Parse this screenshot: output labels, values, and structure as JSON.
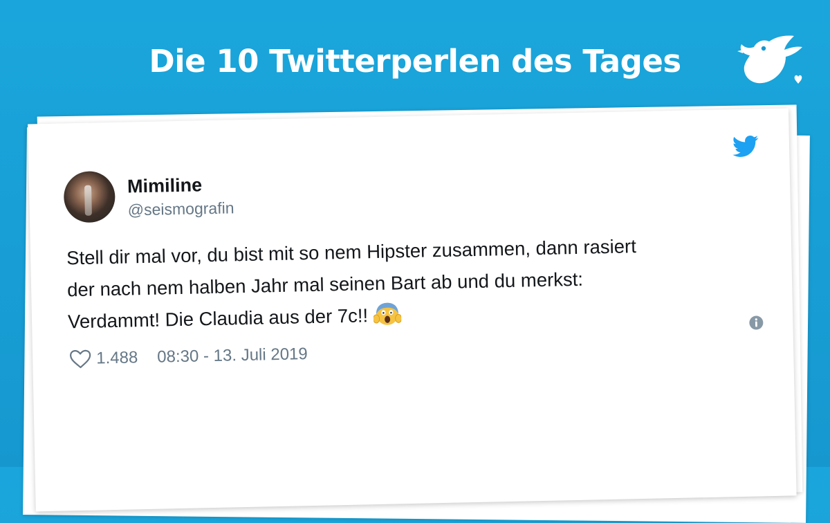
{
  "header": {
    "title": "Die 10 Twitterperlen des Tages",
    "brand_icon": "bird-heart-logo-icon"
  },
  "tweet": {
    "platform_icon": "twitter-bird-icon",
    "avatar_icon": "avatar",
    "display_name": "Mimiline",
    "handle": "@seismografin",
    "text_lines": [
      "Stell dir mal vor, du bist mit so nem Hipster zusammen, dann rasiert",
      "der nach nem halben Jahr mal seinen Bart ab und du merkst:",
      "Verdammt! Die Claudia aus der 7c!!"
    ],
    "emoji": "face-screaming-in-fear-icon",
    "likes_icon": "heart-outline-icon",
    "likes": "1.488",
    "timestamp": "08:30 - 13. Juli 2019",
    "info_icon": "info-icon"
  },
  "colors": {
    "background": "#1aa6dc",
    "twitter_blue": "#1da1f2",
    "muted_text": "#657786",
    "text": "#14171a"
  }
}
